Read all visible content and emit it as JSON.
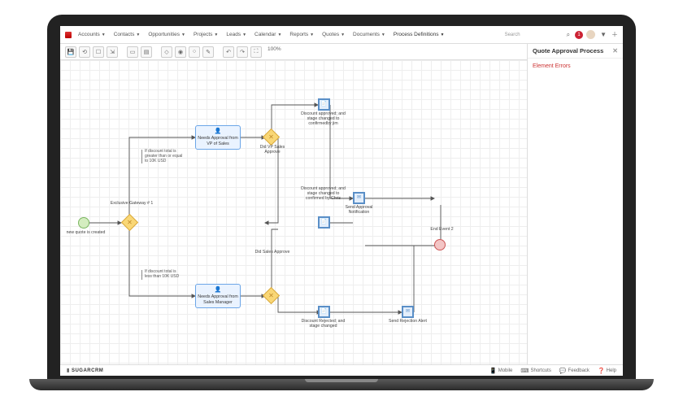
{
  "nav": {
    "items": [
      "Accounts",
      "Contacts",
      "Opportunities",
      "Projects",
      "Leads",
      "Calendar",
      "Reports",
      "Quotes",
      "Documents",
      "Process Definitions"
    ],
    "active_index": 9,
    "search_placeholder": "Search",
    "notification_count": "1"
  },
  "toolbar": {
    "zoom": "100%"
  },
  "side": {
    "title": "Quote Approval Process",
    "error_heading": "Element Errors"
  },
  "footer": {
    "brand": "SUGARCRM",
    "links": [
      "Mobile",
      "Shortcuts",
      "Feedback",
      "Help"
    ]
  },
  "nodes": {
    "start_label": "new quote is created",
    "gw1_label": "Exclusive Gateway # 1",
    "anno_top": "If discount total is greater than or equal to 10K USD",
    "anno_bot": "If discount total is less than 10K USD",
    "task_vp": "Needs Approval from VP of Sales",
    "task_mgr": "Needs Approval from Sales Manager",
    "gw2_label": "Did VP Sales Approve",
    "gw3_label": "Did Sales Approve",
    "evt_top": "Discount approved; and stage changed to confirmedby jim",
    "evt_mid": "Discount approved; and stage changed to confirmed by Chris",
    "evt_bot": "Discount Rejected; and stage changed",
    "send_approval": "Send Approval Notification",
    "send_reject": "Send Rejection Alert",
    "end_label": "End Event 2"
  }
}
